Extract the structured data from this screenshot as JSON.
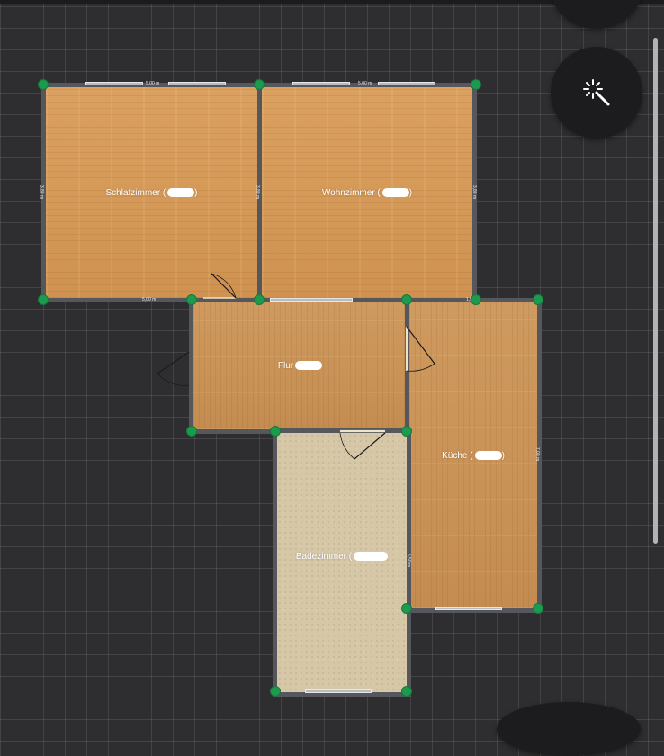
{
  "rooms": [
    {
      "id": "schlafzimmer",
      "label": "Schlafzimmer (",
      "redacted_suffix": ")",
      "floor": "wood"
    },
    {
      "id": "wohnzimmer",
      "label": "Wohnzimmer (",
      "redacted_suffix": ")",
      "floor": "wood"
    },
    {
      "id": "flur",
      "label": "Flur",
      "redacted_suffix": "",
      "floor": "wood"
    },
    {
      "id": "kuche",
      "label": "Küche (",
      "redacted_suffix": ")",
      "floor": "wood"
    },
    {
      "id": "badezimmer",
      "label": "Badezimmer (",
      "redacted_suffix": "",
      "floor": "tile"
    }
  ],
  "dimensions": {
    "schlafzimmer_top": "5,00 m",
    "schlafzimmer_left": "3,80 m",
    "schlafzimmer_bottom": "5,00 m",
    "wohnzimmer_top": "5,00 m",
    "wohnzimmer_left": "3,80 m",
    "wohnzimmer_right": "3,80 m",
    "kuche_top": "1,50 m",
    "kuche_right": "7,00 m",
    "badezimmer_right": "5,50 m"
  },
  "tools": {
    "magic_wand": "magic-wand-icon"
  },
  "colors": {
    "background": "#2e2e30",
    "wall": "#55575d",
    "wood_floor": "#d79a55",
    "tile_floor": "#d6c7a7",
    "node": "#1e9a4f"
  }
}
